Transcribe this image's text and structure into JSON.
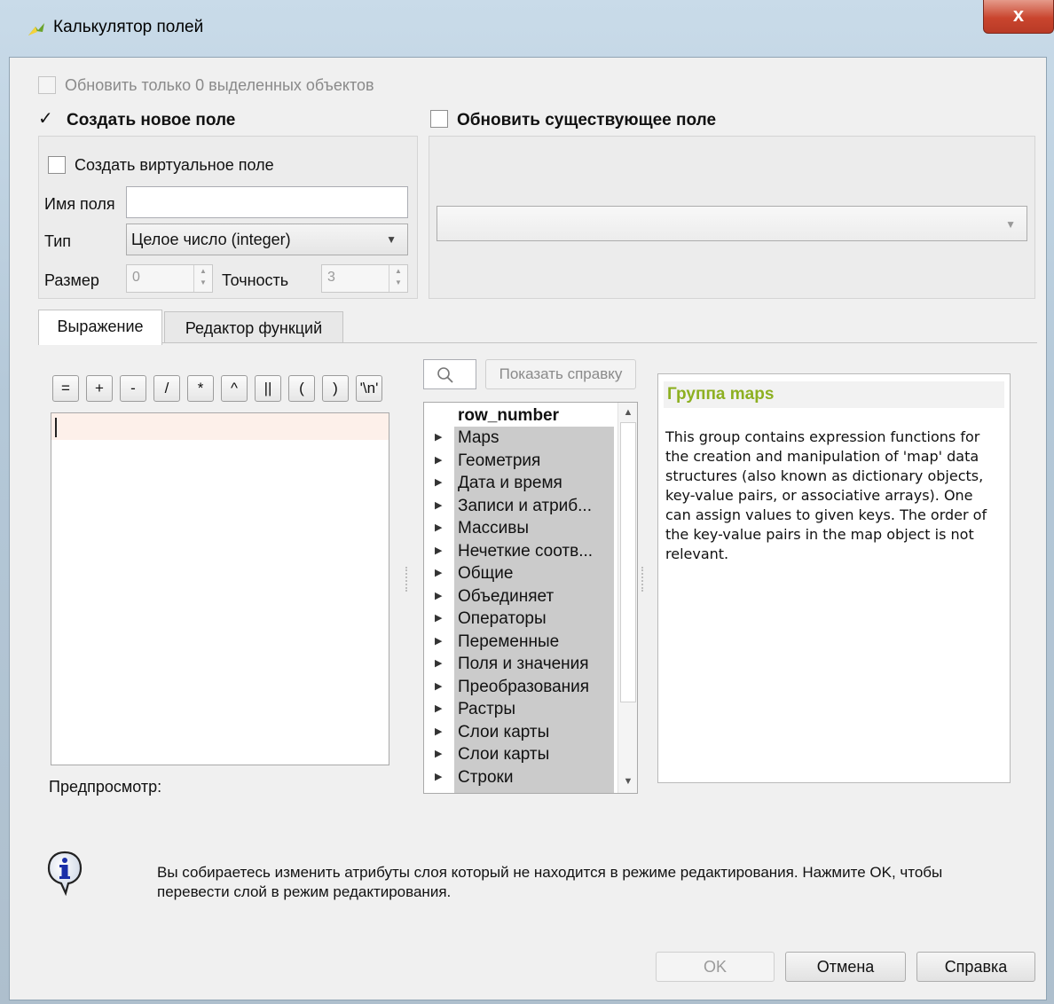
{
  "window": {
    "title": "Калькулятор полей",
    "close_glyph": "x",
    "accent_color": "#c9452e"
  },
  "top": {
    "update_selected_label": "Обновить только 0 выделенных объектов",
    "create_new_field_label": "Создать новое поле",
    "update_existing_field_label": "Обновить существующее поле"
  },
  "new_field": {
    "virtual_label": "Создать виртуальное поле",
    "name_label": "Имя поля",
    "name_value": "",
    "type_label": "Тип",
    "type_value": "Целое число (integer)",
    "size_label": "Размер",
    "size_value": "0",
    "precision_label": "Точность",
    "precision_value": "3"
  },
  "tabs": [
    {
      "label": "Выражение",
      "active": true
    },
    {
      "label": "Редактор функций",
      "active": false
    }
  ],
  "operators": [
    "=",
    "+",
    "-",
    "/",
    "*",
    "^",
    "||",
    "(",
    ")",
    "'\\n'"
  ],
  "preview_label": "Предпросмотр:",
  "search": {
    "icon": "search-icon",
    "help_button": "Показать справку"
  },
  "function_tree": {
    "items": [
      "row_number",
      "Maps",
      "Геометрия",
      "Дата и время",
      "Записи и атриб...",
      "Массивы",
      "Нечеткие соотв...",
      "Общие",
      "Объединяет",
      "Операторы",
      "Переменные",
      "Поля и значения",
      "Преобразования",
      "Растры",
      "Слои карты",
      "Слои карты",
      "Строки"
    ]
  },
  "help": {
    "title": "Группа maps",
    "title_color": "#8db021",
    "body": "This group contains expression functions for the creation and manipulation of 'map' data structures (also known as dictionary objects, key-value pairs, or associative arrays). One can assign values to given keys. The order of the key-value pairs in the map object is not relevant."
  },
  "info": {
    "icon": "info-icon",
    "message": "Вы собираетесь изменить атрибуты слоя который не находится в режиме редактирования. Нажмите OK, чтобы перевести слой в режим редактирования."
  },
  "buttons": {
    "ok": "OK",
    "cancel": "Отмена",
    "help": "Справка"
  }
}
